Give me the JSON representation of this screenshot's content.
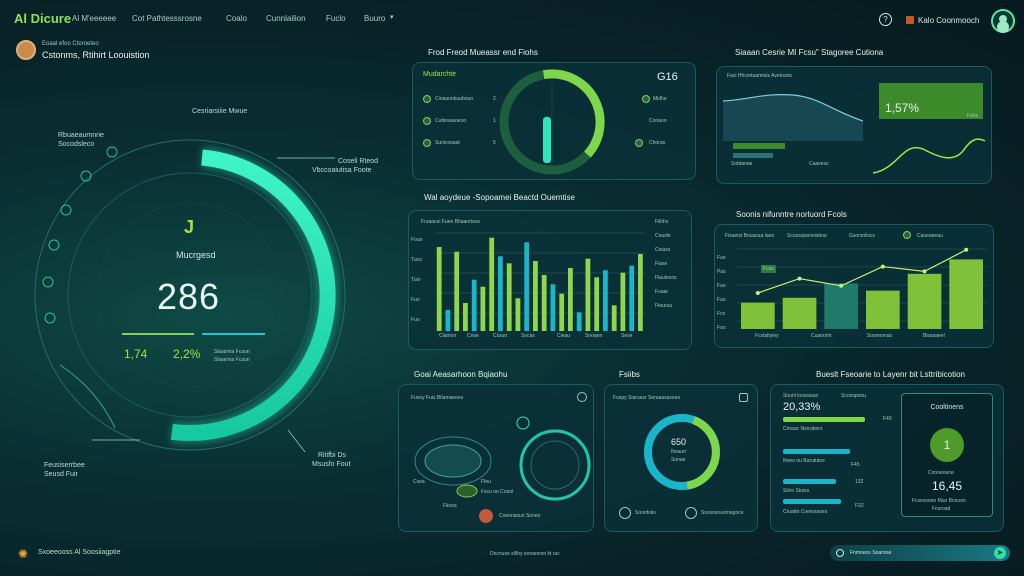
{
  "header": {
    "brand": "Al Dicure",
    "nav": [
      "Al M'eeeeee",
      "Cot Pathtesssrosne",
      "Coalo",
      "Cunnlailion",
      "Fuclo",
      "Buuro"
    ],
    "user_label": "Kalo Coonmooch"
  },
  "user": {
    "line1": "Eoaal efoo Ctoroeteo",
    "line2": "Cstonms, Rtihirt Loouistion"
  },
  "gauge": {
    "value": "286",
    "title": "Mucrgesd",
    "icon_text": "J",
    "label_top": "Cesriarsiiie Mwue",
    "label_left": [
      "Rbuaeaumnrie",
      "Socodsleco"
    ],
    "label_right": [
      "Coseli Rteod",
      "Vbccoaiutisa Foote"
    ],
    "label_bottom_left": [
      "Feusiserrbee",
      "Seusd Fuir"
    ],
    "label_bottom_right": [
      "Ritifbi Ds",
      "Msusfo Fout"
    ],
    "stat1": "1,74",
    "stat2": "2,2%",
    "stat_caption": "Sliaaimia Fcauri",
    "progress": 0.78
  },
  "footer": {
    "left": "Sxoeeooss Al Soosiiagptie",
    "center": "Docnuse si/lhy eonaonnn kt ruc"
  },
  "panel_food": {
    "section_title": "Frod Freod Mueassr end Fiohs",
    "header_label": "Mudarchte",
    "big_value": "G16",
    "rows": [
      {
        "label": "Cinaaonbuabouo",
        "value": "2"
      },
      {
        "label": "Cuttesaaoeoo",
        "value": "1"
      },
      {
        "label": "Sunicosaat",
        "value": "5"
      }
    ],
    "right_labels": [
      "Midhe",
      "Conauo",
      "Chorao"
    ],
    "ring_progress": 0.72
  },
  "panel_trend": {
    "section_title": "Siaaan Cesrie MI Fcsu\" Stagoree Cutiona",
    "header_label": "Fasi Hhvortaamtalz Avetouris",
    "value": "1,57%",
    "sub_label": "Fahs",
    "legend": [
      "Sobtanae",
      "Caavess"
    ],
    "colors": {
      "line": "#5fd64a",
      "area": "#3c8a2a"
    }
  },
  "panel_bars": {
    "section_title": "Wal aoydeue -Sopoamei Beactd Ouemtise",
    "top_label": "Fruaacei Fuee Bhaanrtess",
    "legend": [
      "Fiihhs",
      "Cousfe",
      "Coiuss",
      "Fiase",
      "Flaulooos",
      "Fuaar",
      "Ftoursa"
    ],
    "axis_labels": [
      "Fouo",
      "Tuco",
      "Tuio",
      "Fuo",
      "Fuo",
      "Fuo",
      "Iuo",
      "Fuo"
    ],
    "x_labels": [
      "Clamon",
      "Cnoe",
      "Cssuo",
      "Socas",
      "Cieau",
      "Snoaen",
      "Sese"
    ],
    "bar_values": [
      3.6,
      0.9,
      3.4,
      1.2,
      2.2,
      1.9,
      4.0,
      3.2,
      2.9,
      1.4,
      3.8,
      3.0,
      2.4,
      2.0,
      1.6,
      2.7,
      0.8,
      3.1,
      2.3,
      2.6,
      1.1,
      2.5,
      2.8,
      3.3
    ]
  },
  "panel_sales": {
    "section_title": "Soonis nifunntre norluord Fcols",
    "legend": [
      "Fisaeist Bouasaa laeo",
      "Scunsqoeneisteur",
      "Gsorsnliscs",
      "Caueaeeau"
    ],
    "axis_labels": [
      "Fuo",
      "Pas",
      "Fuo",
      "Fuo",
      "Fco",
      "Foo"
    ],
    "x_labels": [
      "Fcstaltyiey",
      "Cuaoorrir",
      "Sosenonas",
      "Bissaaeel"
    ],
    "callout": "Fosu",
    "bar_values": [
      22,
      26,
      38,
      32,
      46,
      58
    ],
    "line_values": [
      30,
      42,
      36,
      52,
      48,
      66
    ]
  },
  "panel_scan": {
    "section_title": "Goai Aeasarhoon Bqiaohu",
    "header_label": "Fusoy Fuis Btlamaeees",
    "labels": [
      "Csea",
      "Fiiooa",
      "Ffeu",
      "Fscu oo Cunol",
      "Coeonasuo Soneo"
    ]
  },
  "panel_donut": {
    "section_title": "Fsiibs",
    "header_label": "Fuspy Siaruasr Seraaasasees",
    "value": "650",
    "sub": [
      "Noaurr",
      "Sonae"
    ],
    "legend": [
      "Soonfoiiu",
      "Ssososouomagoce"
    ],
    "progress": 0.42
  },
  "panel_gamification": {
    "section_title": "Bueslt Fseoarie to Layenr bit Lsttribicotion",
    "top_labels": [
      "Sounl loossiauo",
      "Sconspoou"
    ],
    "value": "20,33%",
    "bars": [
      {
        "label": "Crnaac Nsrrabors",
        "value": "F49",
        "fill": 0.85
      },
      {
        "label": "Noeo ou Burututos",
        "value": "F45",
        "fill": 0.7
      },
      {
        "label": "Siirio Stuiss",
        "value": "132",
        "fill": 0.55
      },
      {
        "label": "Cruatto Coeiosaoes",
        "value": "F32",
        "fill": 0.6
      }
    ],
    "mini_title": "Cooltinens",
    "mini_value": "16,45",
    "mini_caption": [
      "Conoeoune",
      "Fcsessone Muo Bcouon",
      "Fcuroad"
    ],
    "mini_icon": "1"
  },
  "search": {
    "placeholder": "Fnmoeos Soarooa"
  }
}
